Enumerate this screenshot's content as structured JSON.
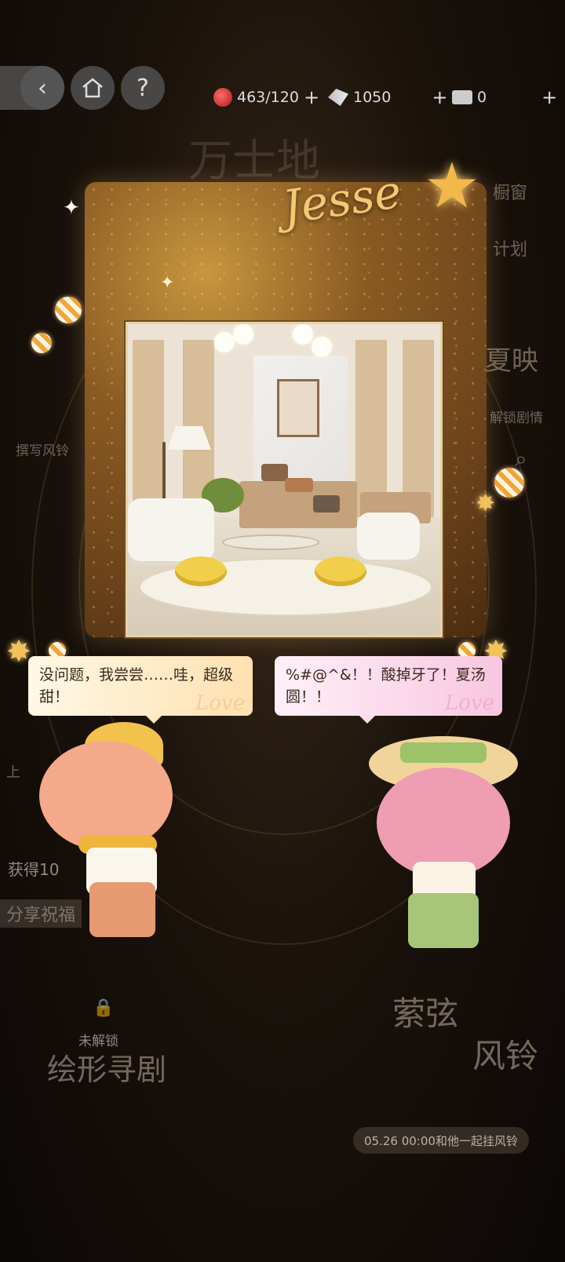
{
  "nav": {
    "back_icon": "chevron-left-icon",
    "home_icon": "home-icon",
    "help_label": "?"
  },
  "resources": [
    {
      "icon": "apple-icon",
      "value": "463/120",
      "plus": "+"
    },
    {
      "icon": "wing-coin-icon",
      "value": "1050",
      "plus": "+"
    },
    {
      "icon": "ticket-icon",
      "value": "0",
      "plus": "+"
    }
  ],
  "background": {
    "top_title": "万士地",
    "side_right": [
      "橱窗",
      "计划"
    ],
    "right_replay": "夏映",
    "right_unlock": "解锁剧情",
    "left_write": "撰写风铃",
    "left_gain": "获得10",
    "left_share": "分享祝福",
    "left_prev": "上",
    "bottom_left_title": "绘形寻剧",
    "bottom_left_lock": "未解锁",
    "bottom_right_title_1": "萦弦",
    "bottom_right_title_2": "风铃",
    "bottom_right_date": "05.26 00:00和他一起挂风铃"
  },
  "card": {
    "logo": "Jesse"
  },
  "dialogue": {
    "left": "没问题，我尝尝……哇，超级甜！",
    "right": "%#@^&！！酸掉牙了！夏汤圆！！",
    "deco_word": "Love"
  },
  "colors": {
    "card_gold": "#c7963f",
    "bubble_left": "#ffe0b0",
    "bubble_right": "#f8c6e0",
    "pouf_yellow": "#f2cf4b"
  }
}
